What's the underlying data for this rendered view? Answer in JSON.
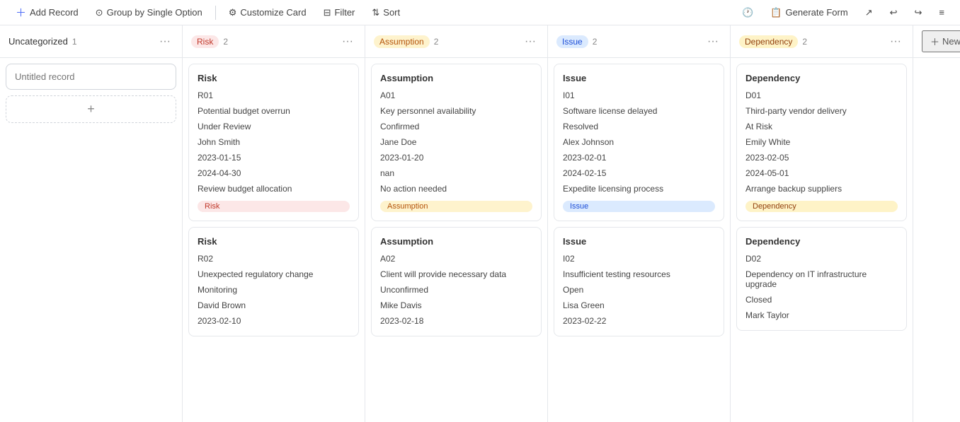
{
  "toolbar": {
    "add_record": "Add Record",
    "group_by": "Group by Single Option",
    "customize_card": "Customize Card",
    "filter": "Filter",
    "sort": "Sort",
    "generate_form": "Generate Form"
  },
  "columns": [
    {
      "id": "uncategorized",
      "label": "Uncategorized",
      "count": 1,
      "badge_class": "",
      "cards": [
        {
          "title": null,
          "placeholder": "Untitled record",
          "is_input": true
        }
      ]
    },
    {
      "id": "risk",
      "label": "Risk",
      "count": 2,
      "badge_class": "badge-risk",
      "cards": [
        {
          "title": "Risk",
          "rows": [
            "R01",
            "Potential budget overrun",
            "Under Review",
            "John Smith",
            "2023-01-15",
            "2024-04-30",
            "Review budget allocation"
          ],
          "tag": "Risk",
          "tag_class": "badge-risk"
        },
        {
          "title": "Risk",
          "rows": [
            "R02",
            "Unexpected regulatory change",
            "Monitoring",
            "David Brown",
            "2023-02-10"
          ],
          "tag": null
        }
      ]
    },
    {
      "id": "assumption",
      "label": "Assumption",
      "count": 2,
      "badge_class": "badge-assumption",
      "cards": [
        {
          "title": "Assumption",
          "rows": [
            "A01",
            "Key personnel availability",
            "Confirmed",
            "Jane Doe",
            "2023-01-20",
            "nan",
            "No action needed"
          ],
          "tag": "Assumption",
          "tag_class": "badge-assumption"
        },
        {
          "title": "Assumption",
          "rows": [
            "A02",
            "Client will provide necessary data",
            "Unconfirmed",
            "Mike Davis",
            "2023-02-18"
          ],
          "tag": null
        }
      ]
    },
    {
      "id": "issue",
      "label": "Issue",
      "count": 2,
      "badge_class": "badge-issue",
      "cards": [
        {
          "title": "Issue",
          "rows": [
            "I01",
            "Software license delayed",
            "Resolved",
            "Alex Johnson",
            "2023-02-01",
            "2024-02-15",
            "Expedite licensing process"
          ],
          "tag": "Issue",
          "tag_class": "badge-issue"
        },
        {
          "title": "Issue",
          "rows": [
            "I02",
            "Insufficient testing resources",
            "Open",
            "Lisa Green",
            "2023-02-22"
          ],
          "tag": null
        }
      ]
    },
    {
      "id": "dependency",
      "label": "Dependency",
      "count": 2,
      "badge_class": "badge-dependency",
      "cards": [
        {
          "title": "Dependency",
          "rows": [
            "D01",
            "Third-party vendor delivery",
            "At Risk",
            "Emily White",
            "2023-02-05",
            "2024-05-01",
            "Arrange backup suppliers"
          ],
          "tag": "Dependency",
          "tag_class": "badge-dependency"
        },
        {
          "title": "Dependency",
          "rows": [
            "D02",
            "Dependency on IT infrastructure upgrade",
            "Closed",
            "Mark Taylor"
          ],
          "tag": null
        }
      ]
    }
  ],
  "new_button": "New"
}
